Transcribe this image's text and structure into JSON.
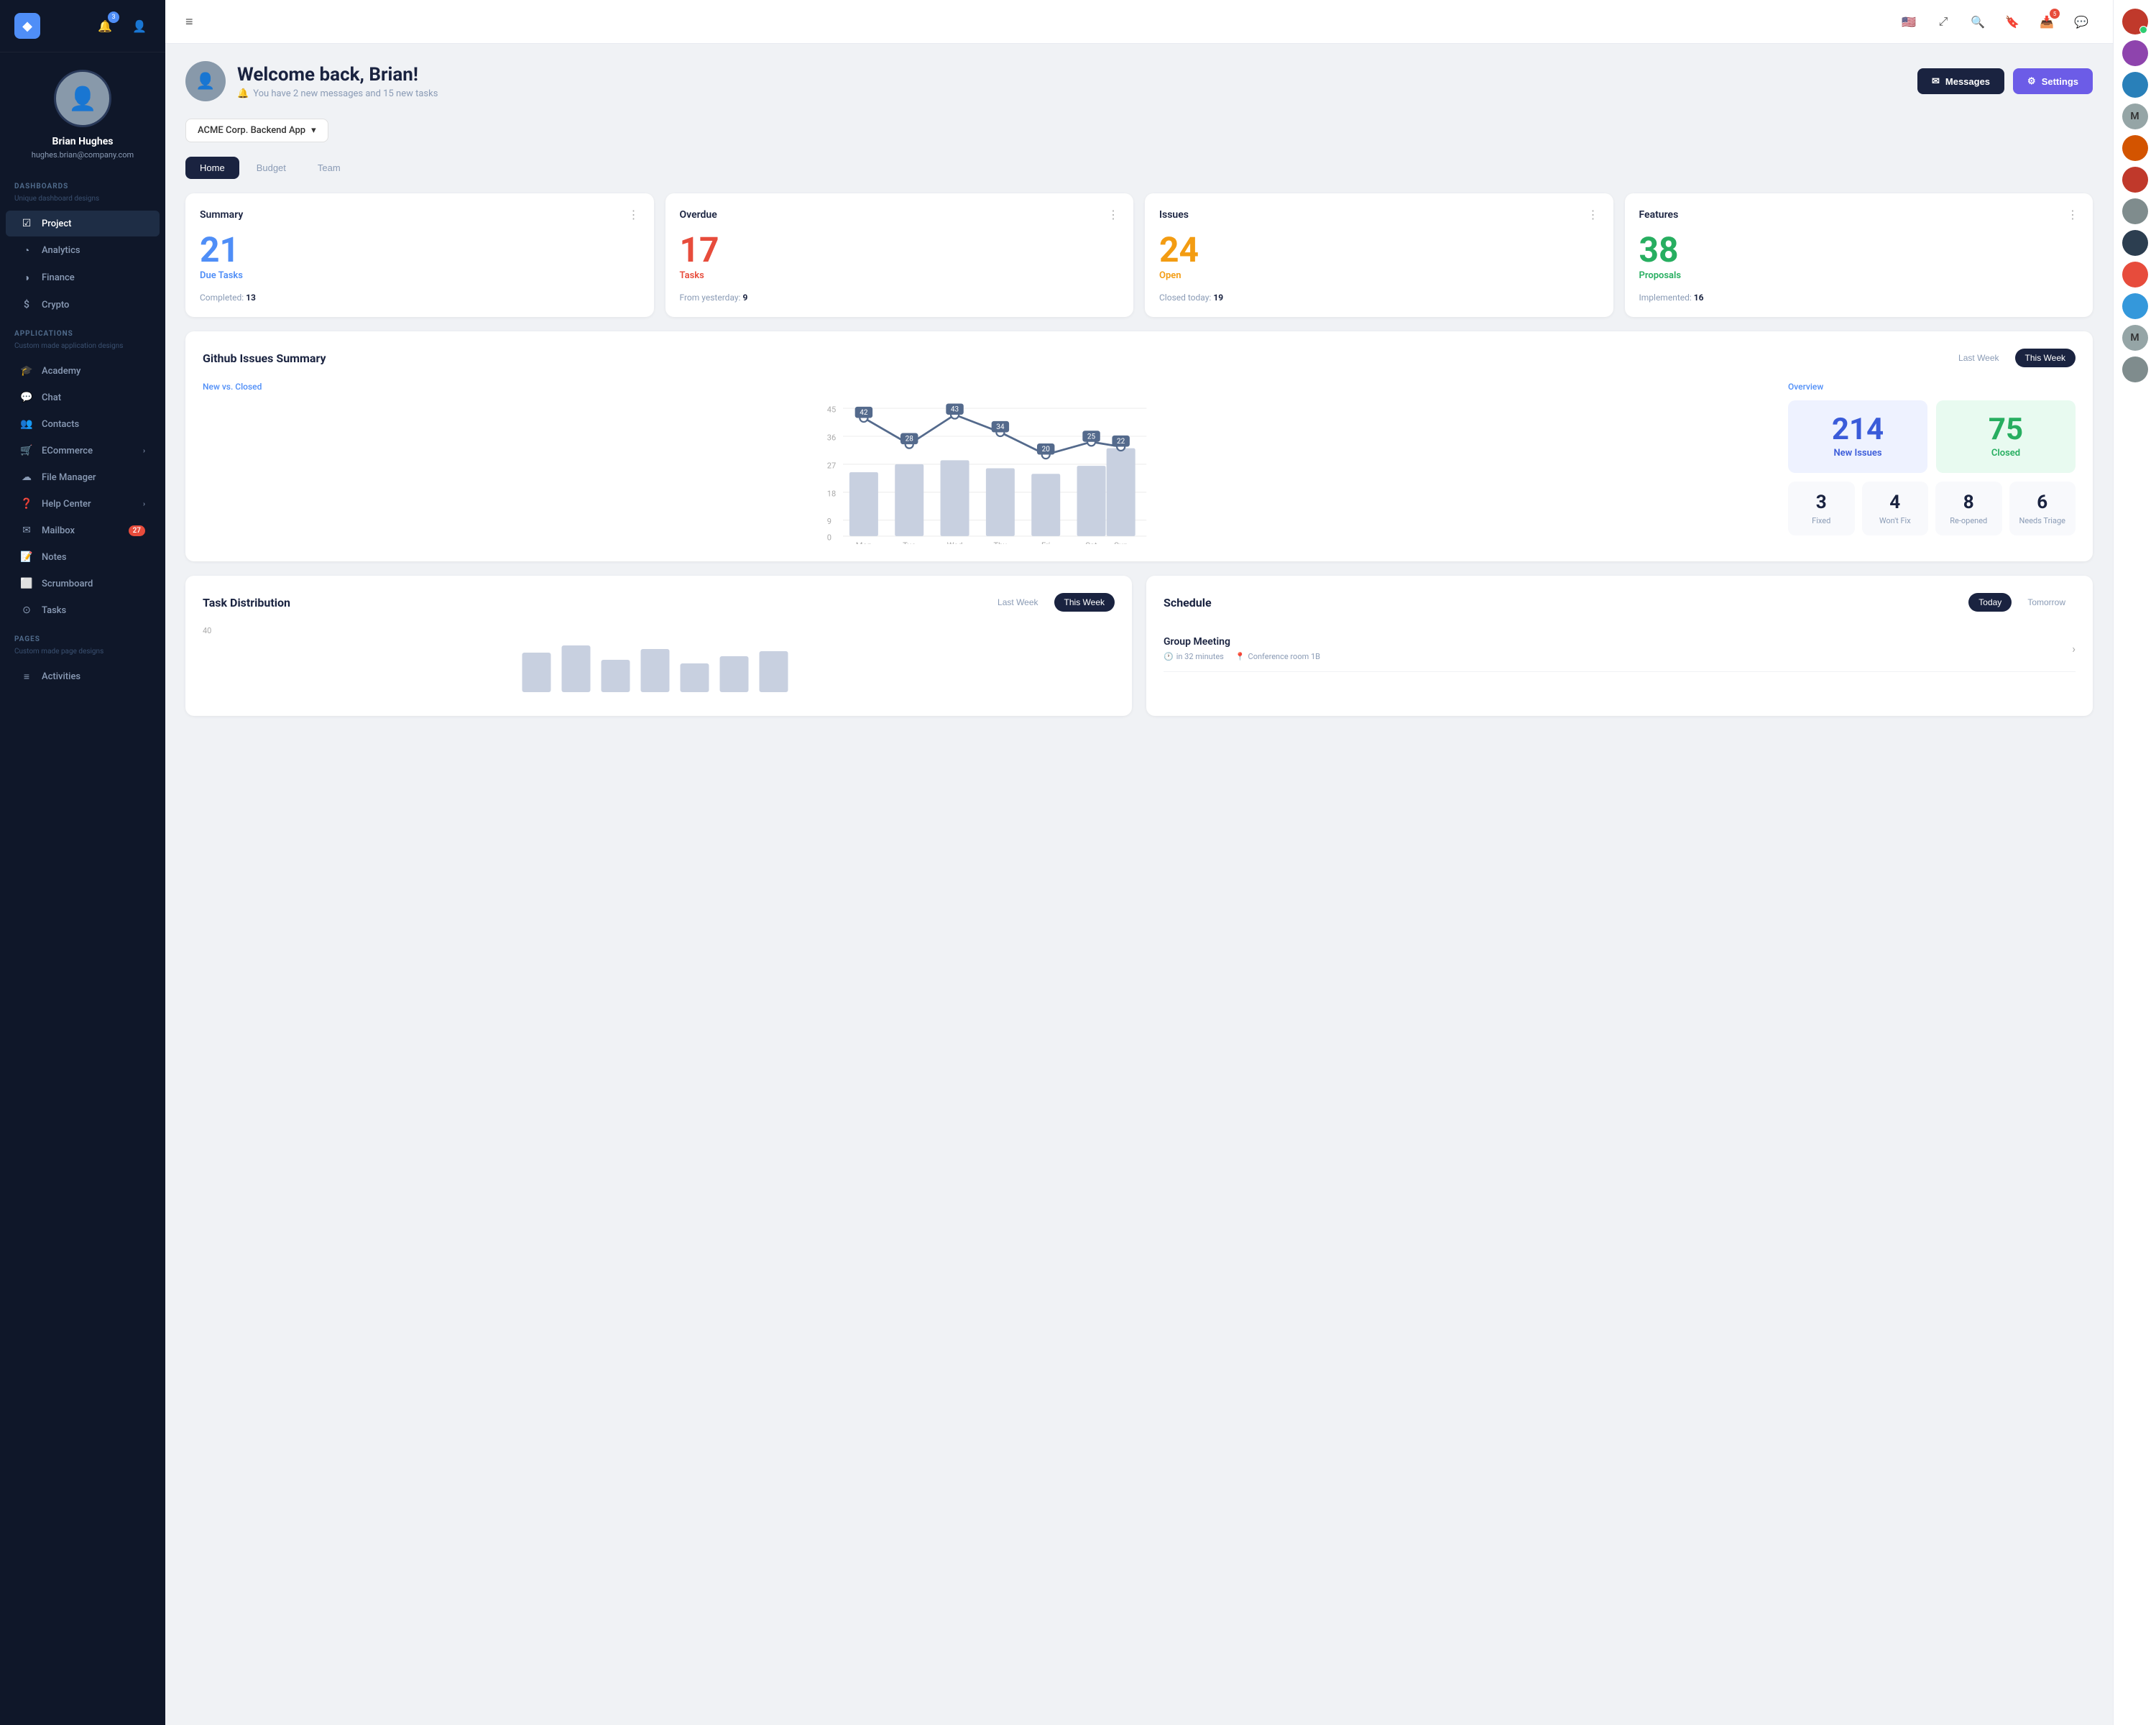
{
  "sidebar": {
    "logo_icon": "◆",
    "notifications_badge": "3",
    "user": {
      "name": "Brian Hughes",
      "email": "hughes.brian@company.com",
      "avatar_placeholder": "👤"
    },
    "sections": [
      {
        "label": "DASHBOARDS",
        "sub": "Unique dashboard designs",
        "items": [
          {
            "id": "project",
            "label": "Project",
            "icon": "☑",
            "active": true
          },
          {
            "id": "analytics",
            "label": "Analytics",
            "icon": "◔"
          },
          {
            "id": "finance",
            "label": "Finance",
            "icon": "◑"
          },
          {
            "id": "crypto",
            "label": "Crypto",
            "icon": "$"
          }
        ]
      },
      {
        "label": "APPLICATIONS",
        "sub": "Custom made application designs",
        "items": [
          {
            "id": "academy",
            "label": "Academy",
            "icon": "🎓"
          },
          {
            "id": "chat",
            "label": "Chat",
            "icon": "💬"
          },
          {
            "id": "contacts",
            "label": "Contacts",
            "icon": "👥"
          },
          {
            "id": "ecommerce",
            "label": "ECommerce",
            "icon": "🛒",
            "chevron": true
          },
          {
            "id": "filemanager",
            "label": "File Manager",
            "icon": "☁"
          },
          {
            "id": "helpcenter",
            "label": "Help Center",
            "icon": "❓",
            "chevron": true
          },
          {
            "id": "mailbox",
            "label": "Mailbox",
            "icon": "✉",
            "badge": "27"
          },
          {
            "id": "notes",
            "label": "Notes",
            "icon": "📝"
          },
          {
            "id": "scrumboard",
            "label": "Scrumboard",
            "icon": "⬜"
          },
          {
            "id": "tasks",
            "label": "Tasks",
            "icon": "⊙"
          }
        ]
      },
      {
        "label": "PAGES",
        "sub": "Custom made page designs",
        "items": [
          {
            "id": "activities",
            "label": "Activities",
            "icon": "≡"
          }
        ]
      }
    ]
  },
  "topbar": {
    "us_flag": "🇺🇸",
    "icons": [
      "⤢",
      "🔍",
      "🔖"
    ],
    "inbox_badge": "5",
    "chat_icon": "💬"
  },
  "header": {
    "welcome_text": "Welcome back, Brian!",
    "subtitle": "You have 2 new messages and 15 new tasks",
    "btn_messages": "Messages",
    "btn_settings": "Settings"
  },
  "project_selector": {
    "label": "ACME Corp. Backend App"
  },
  "tabs": [
    "Home",
    "Budget",
    "Team"
  ],
  "active_tab": "Home",
  "summary_cards": [
    {
      "title": "Summary",
      "number": "21",
      "label": "Due Tasks",
      "label_color": "blue",
      "footer_key": "Completed:",
      "footer_val": "13"
    },
    {
      "title": "Overdue",
      "number": "17",
      "label": "Tasks",
      "label_color": "red",
      "footer_key": "From yesterday:",
      "footer_val": "9"
    },
    {
      "title": "Issues",
      "number": "24",
      "label": "Open",
      "label_color": "orange",
      "footer_key": "Closed today:",
      "footer_val": "19"
    },
    {
      "title": "Features",
      "number": "38",
      "label": "Proposals",
      "label_color": "green",
      "footer_key": "Implemented:",
      "footer_val": "16"
    }
  ],
  "github": {
    "title": "Github Issues Summary",
    "chart_label": "New vs. Closed",
    "overview_label": "Overview",
    "week_toggle": [
      "Last Week",
      "This Week"
    ],
    "active_week": "This Week",
    "chart": {
      "days": [
        "Mon",
        "Tue",
        "Wed",
        "Thu",
        "Fri",
        "Sat",
        "Sun"
      ],
      "line_values": [
        42,
        28,
        43,
        34,
        20,
        25,
        22
      ],
      "bar_heights": [
        75,
        65,
        80,
        60,
        55,
        70,
        90
      ]
    },
    "overview": {
      "new_issues": "214",
      "new_issues_label": "New Issues",
      "closed": "75",
      "closed_label": "Closed"
    },
    "stats": [
      {
        "num": "3",
        "label": "Fixed"
      },
      {
        "num": "4",
        "label": "Won't Fix"
      },
      {
        "num": "8",
        "label": "Re-opened"
      },
      {
        "num": "6",
        "label": "Needs Triage"
      }
    ]
  },
  "task_dist": {
    "title": "Task Distribution",
    "week_toggle": [
      "Last Week",
      "This Week"
    ],
    "active_week": "This Week",
    "chart_max": "40"
  },
  "schedule": {
    "title": "Schedule",
    "toggle": [
      "Today",
      "Tomorrow"
    ],
    "active": "Today",
    "events": [
      {
        "title": "Group Meeting",
        "time": "in 32 minutes",
        "location": "Conference room 1B"
      }
    ]
  },
  "avatar_bar": [
    {
      "color": "#c0392b",
      "initial": ""
    },
    {
      "color": "#8e44ad",
      "initial": "",
      "online": true
    },
    {
      "color": "#2980b9",
      "initial": ""
    },
    {
      "color": "#27ae60",
      "initial": "M"
    },
    {
      "color": "#d35400",
      "initial": ""
    },
    {
      "color": "#16a085",
      "initial": ""
    },
    {
      "color": "#8e44ad",
      "initial": ""
    },
    {
      "color": "#2c3e50",
      "initial": ""
    },
    {
      "color": "#e74c3c",
      "initial": ""
    },
    {
      "color": "#3498db",
      "initial": ""
    },
    {
      "color": "#2ecc71",
      "initial": "M"
    },
    {
      "color": "#95a5a6",
      "initial": ""
    }
  ]
}
